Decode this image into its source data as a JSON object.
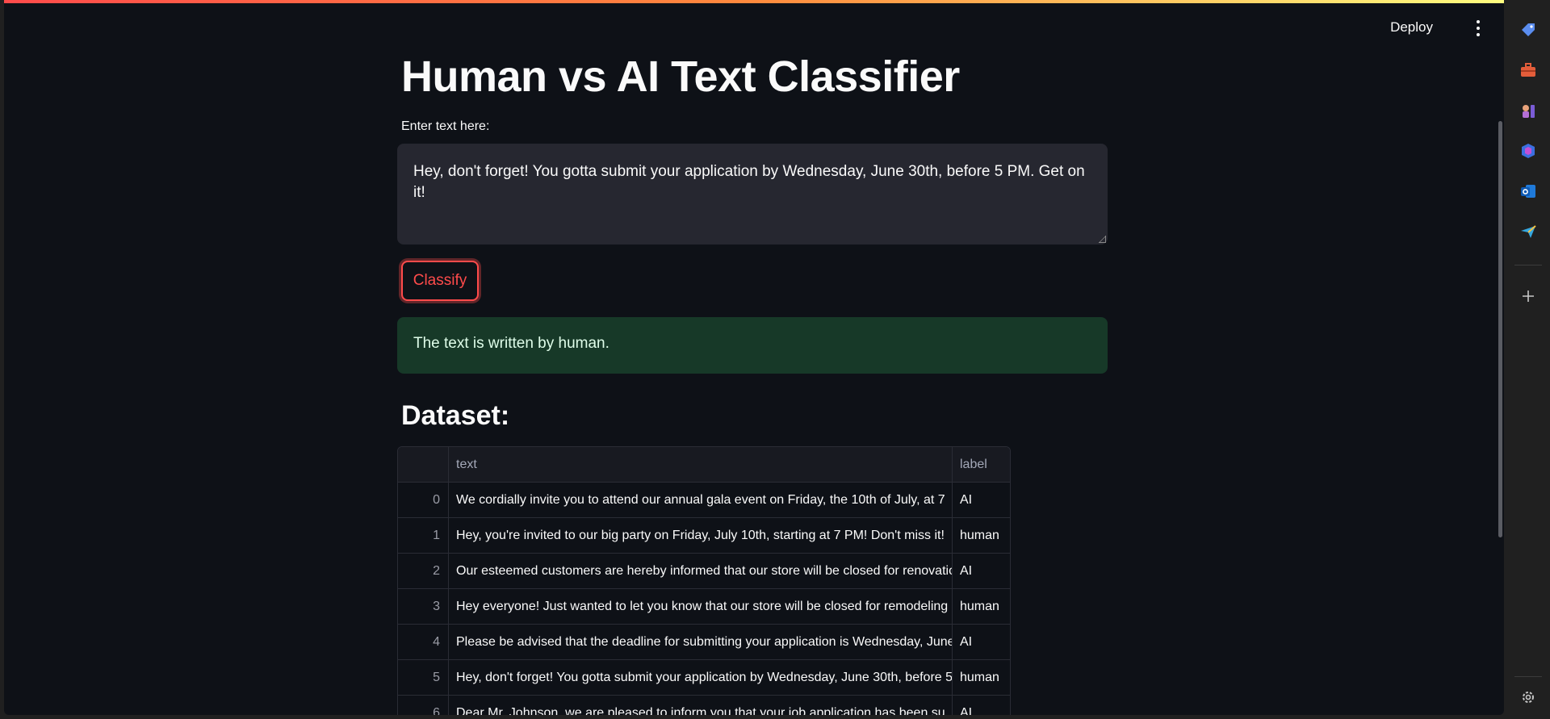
{
  "header": {
    "deploy_label": "Deploy"
  },
  "main": {
    "title": "Human vs AI Text Classifier",
    "input_label": "Enter text here:",
    "input_value": "Hey, don't forget! You gotta submit your application by Wednesday, June 30th, before 5 PM. Get on it!",
    "classify_label": "Classify",
    "result_text": "The text is written by human.",
    "dataset_heading": "Dataset:"
  },
  "dataset": {
    "columns": [
      "",
      "text",
      "label"
    ],
    "rows": [
      {
        "index": "0",
        "text": "We cordially invite you to attend our annual gala event on Friday, the 10th of July, at 7",
        "label": "AI"
      },
      {
        "index": "1",
        "text": "Hey, you're invited to our big party on Friday, July 10th, starting at 7 PM! Don't miss it!",
        "label": "human"
      },
      {
        "index": "2",
        "text": "Our esteemed customers are hereby informed that our store will be closed for renovation",
        "label": "AI"
      },
      {
        "index": "3",
        "text": "Hey everyone! Just wanted to let you know that our store will be closed for remodeling",
        "label": "human"
      },
      {
        "index": "4",
        "text": "Please be advised that the deadline for submitting your application is Wednesday, June",
        "label": "AI"
      },
      {
        "index": "5",
        "text": "Hey, don't forget! You gotta submit your application by Wednesday, June 30th, before 5",
        "label": "human"
      },
      {
        "index": "6",
        "text": "Dear Mr. Johnson, we are pleased to inform you that your job application has been su",
        "label": "AI"
      }
    ]
  },
  "sidebar": {
    "icons": [
      "tag-icon",
      "briefcase-icon",
      "games-icon",
      "copilot-icon",
      "outlook-icon",
      "send-icon",
      "add-icon",
      "settings-icon"
    ]
  },
  "colors": {
    "accent": "#ff4b4b",
    "background": "#0e1117",
    "success_bg": "#173928"
  }
}
